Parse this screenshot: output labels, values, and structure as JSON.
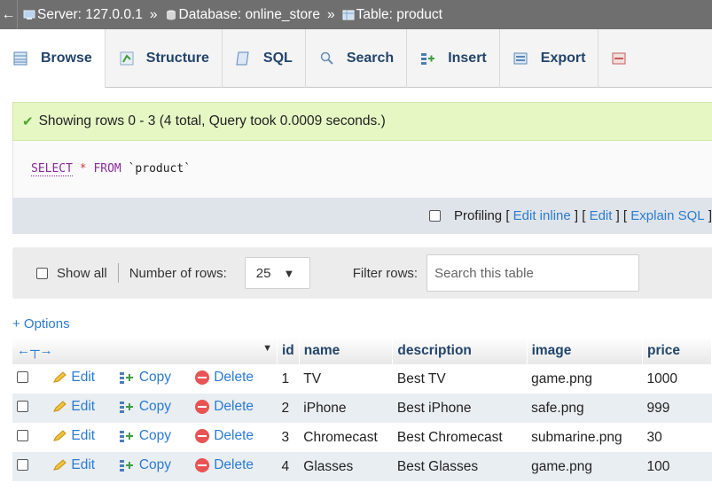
{
  "breadcrumb": {
    "back": "←",
    "server": "Server: 127.0.0.1",
    "database": "Database: online_store",
    "table": "Table: product",
    "separator": "»"
  },
  "tabs": [
    {
      "label": "Browse",
      "icon": "browse-icon",
      "active": true
    },
    {
      "label": "Structure",
      "icon": "structure-icon",
      "active": false
    },
    {
      "label": "SQL",
      "icon": "sql-icon",
      "active": false
    },
    {
      "label": "Search",
      "icon": "search-icon",
      "active": false
    },
    {
      "label": "Insert",
      "icon": "insert-icon",
      "active": false
    },
    {
      "label": "Export",
      "icon": "export-icon",
      "active": false
    }
  ],
  "message": "Showing rows 0 - 3 (4 total, Query took 0.0009 seconds.)",
  "sql": {
    "select": "SELECT",
    "star": "*",
    "from": "FROM",
    "table": "`product`"
  },
  "profiling": {
    "label": "Profiling",
    "edit_inline": "Edit inline",
    "edit": "Edit",
    "explain": "Explain SQL"
  },
  "nav": {
    "show_all": "Show all",
    "number_of_rows_label": "Number of rows:",
    "rows_value": "25",
    "filter_label": "Filter rows:",
    "search_placeholder": "Search this table"
  },
  "options_link": "+ Options",
  "table": {
    "headers": [
      "id",
      "name",
      "description",
      "image",
      "price"
    ],
    "actions": {
      "edit": "Edit",
      "copy": "Copy",
      "delete": "Delete"
    },
    "rows": [
      {
        "id": "1",
        "name": "TV",
        "description": "Best TV",
        "image": "game.png",
        "price": "1000"
      },
      {
        "id": "2",
        "name": "iPhone",
        "description": "Best iPhone",
        "image": "safe.png",
        "price": "999"
      },
      {
        "id": "3",
        "name": "Chromecast",
        "description": "Best Chromecast",
        "image": "submarine.png",
        "price": "30"
      },
      {
        "id": "4",
        "name": "Glasses",
        "description": "Best Glasses",
        "image": "game.png",
        "price": "100"
      }
    ]
  },
  "colors": {
    "tab_text": "#23456b",
    "link": "#2a7bd1",
    "success_bg": "#e6f7c4",
    "row_alt": "#e9eef2"
  }
}
